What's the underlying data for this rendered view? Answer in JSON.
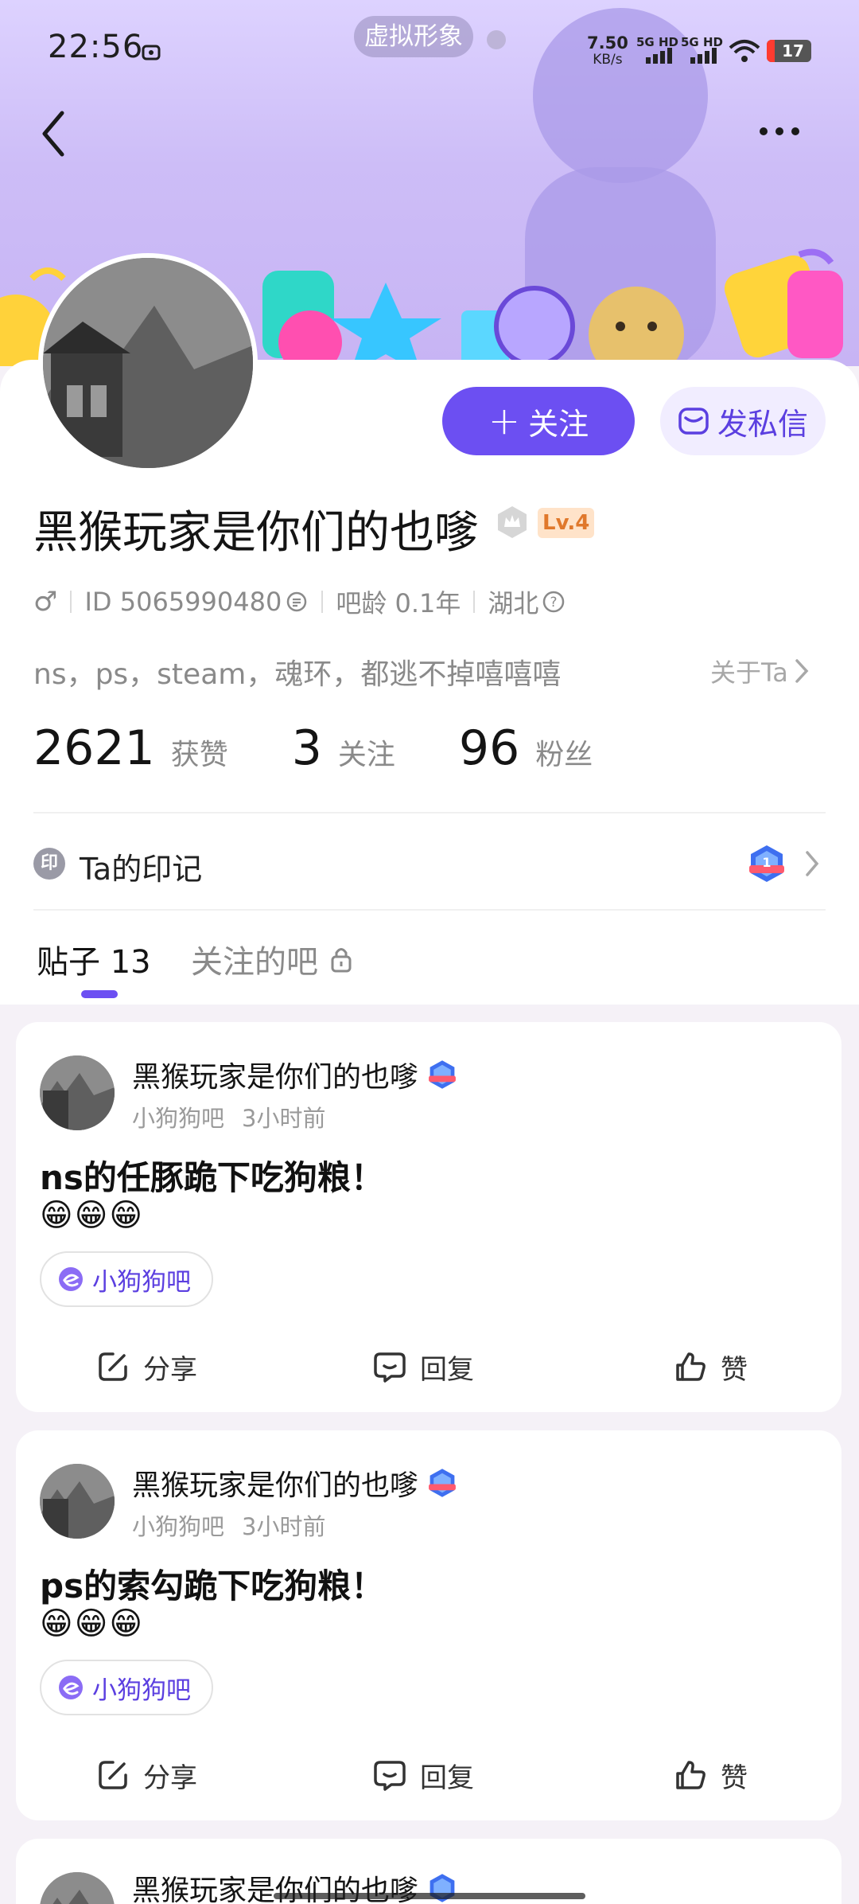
{
  "status_bar": {
    "time": "22:56",
    "virtual_pill": "虚拟形象",
    "net_speed_value": "7.50",
    "net_speed_unit": "KB/s",
    "network_label": "5G HD",
    "battery": "17"
  },
  "profile": {
    "follow_label": "关注",
    "dm_label": "发私信",
    "username": "黑猴玩家是你们的也嗲",
    "level": "Lv.4",
    "id_text": "ID 5065990480",
    "bar_age": "吧龄 0.1年",
    "location": "湖北",
    "bio": "ns，ps，steam，魂环，都逃不掉嘻嘻嘻",
    "about_link": "关于Ta"
  },
  "stats": [
    {
      "value": "2621",
      "label": "获赞"
    },
    {
      "value": "3",
      "label": "关注"
    },
    {
      "value": "96",
      "label": "粉丝"
    }
  ],
  "seal": {
    "icon_text": "印",
    "label": "Ta的印记"
  },
  "tabs": {
    "posts": "贴子 13",
    "followed_bars": "关注的吧"
  },
  "posts": [
    {
      "author": "黑猴玩家是你们的也嗲",
      "bar": "小狗狗吧",
      "time": "3小时前",
      "title": "ns的任豚跪下吃狗粮！",
      "emoji": "😁😁😁",
      "tag": "小狗狗吧",
      "share": "分享",
      "reply": "回复",
      "like": "赞"
    },
    {
      "author": "黑猴玩家是你们的也嗲",
      "bar": "小狗狗吧",
      "time": "3小时前",
      "title": "ps的索勾跪下吃狗粮！",
      "emoji": "😁😁😁",
      "tag": "小狗狗吧",
      "share": "分享",
      "reply": "回复",
      "like": "赞"
    },
    {
      "author": "黑猴玩家是你们的也嗲"
    }
  ],
  "colors": {
    "accent": "#6c4ff2",
    "accent_soft": "#f1edff",
    "level_bg": "#ffe3c9",
    "level_fg": "#e0782b",
    "banner_top": "#ddd2ff",
    "banner_bottom": "#c7b4f4"
  }
}
